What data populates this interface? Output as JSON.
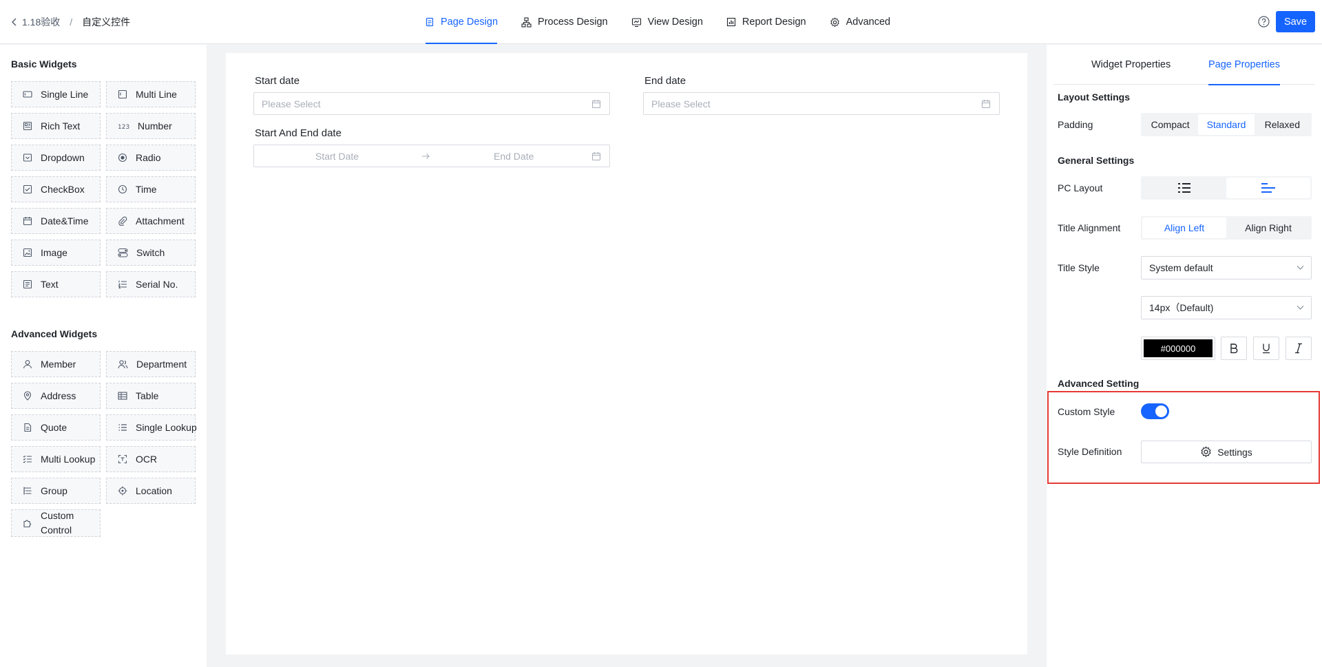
{
  "breadcrumb": {
    "parent": "1.18验收",
    "separator": "/",
    "current": "自定义控件"
  },
  "nav_tabs": [
    {
      "label": "Page Design",
      "icon": "page-icon",
      "active": true
    },
    {
      "label": "Process Design",
      "icon": "process-icon",
      "active": false
    },
    {
      "label": "View Design",
      "icon": "view-icon",
      "active": false
    },
    {
      "label": "Report Design",
      "icon": "report-icon",
      "active": false
    },
    {
      "label": "Advanced",
      "icon": "gear-icon",
      "active": false
    }
  ],
  "header": {
    "save_label": "Save"
  },
  "basic_widgets": {
    "title": "Basic Widgets",
    "items": [
      {
        "label": "Single Line",
        "icon": "single-line-icon"
      },
      {
        "label": "Multi Line",
        "icon": "multi-line-icon"
      },
      {
        "label": "Rich Text",
        "icon": "rich-text-icon"
      },
      {
        "label": "Number",
        "icon": "number-icon"
      },
      {
        "label": "Dropdown",
        "icon": "dropdown-icon"
      },
      {
        "label": "Radio",
        "icon": "radio-icon"
      },
      {
        "label": "CheckBox",
        "icon": "checkbox-icon"
      },
      {
        "label": "Time",
        "icon": "clock-icon"
      },
      {
        "label": "Date&Time",
        "icon": "calendar-icon"
      },
      {
        "label": "Attachment",
        "icon": "paperclip-icon"
      },
      {
        "label": "Image",
        "icon": "image-icon"
      },
      {
        "label": "Switch",
        "icon": "switch-icon"
      },
      {
        "label": "Text",
        "icon": "text-icon"
      },
      {
        "label": "Serial No.",
        "icon": "serial-icon"
      }
    ]
  },
  "advanced_widgets": {
    "title": "Advanced Widgets",
    "items": [
      {
        "label": "Member",
        "icon": "user-icon"
      },
      {
        "label": "Department",
        "icon": "department-icon"
      },
      {
        "label": "Address",
        "icon": "location-pin-icon"
      },
      {
        "label": "Table",
        "icon": "table-icon"
      },
      {
        "label": "Quote",
        "icon": "quote-icon"
      },
      {
        "label": "Single Lookup",
        "icon": "list-icon"
      },
      {
        "label": "Multi Lookup",
        "icon": "checklist-icon"
      },
      {
        "label": "OCR",
        "icon": "scan-icon"
      },
      {
        "label": "Group",
        "icon": "group-icon"
      },
      {
        "label": "Location",
        "icon": "crosshair-icon"
      },
      {
        "label": "Custom Control",
        "icon": "puzzle-icon"
      }
    ]
  },
  "canvas": {
    "start_date": {
      "label": "Start date",
      "placeholder": "Please Select"
    },
    "end_date": {
      "label": "End date",
      "placeholder": "Please Select"
    },
    "range": {
      "label": "Start And End date",
      "start_placeholder": "Start Date",
      "end_placeholder": "End Date"
    }
  },
  "properties": {
    "tabs": [
      {
        "label": "Widget Properties",
        "active": false
      },
      {
        "label": "Page Properties",
        "active": true
      }
    ],
    "layout_settings": {
      "title": "Layout Settings",
      "padding_label": "Padding",
      "padding_options": [
        "Compact",
        "Standard",
        "Relaxed"
      ],
      "padding_selected": "Standard"
    },
    "general_settings": {
      "title": "General Settings",
      "pc_layout_label": "PC Layout",
      "pc_layout_options": [
        "list-layout-icon",
        "left-align-layout-icon"
      ],
      "pc_layout_selected": "left-align-layout-icon",
      "title_alignment_label": "Title Alignment",
      "title_alignment_options": [
        "Align Left",
        "Align Right"
      ],
      "title_alignment_selected": "Align Left",
      "title_style_label": "Title Style",
      "font_family_value": "System default",
      "font_size_value": "14px（Default)",
      "color_value": "#000000",
      "format_buttons": [
        "bold-icon",
        "underline-icon",
        "italic-icon"
      ]
    },
    "advanced_setting": {
      "title": "Advanced Setting",
      "custom_style_label": "Custom Style",
      "custom_style_on": true,
      "style_definition_label": "Style Definition",
      "settings_button_label": "Settings"
    }
  },
  "colors": {
    "accent": "#1664ff",
    "highlight": "#e53935"
  }
}
